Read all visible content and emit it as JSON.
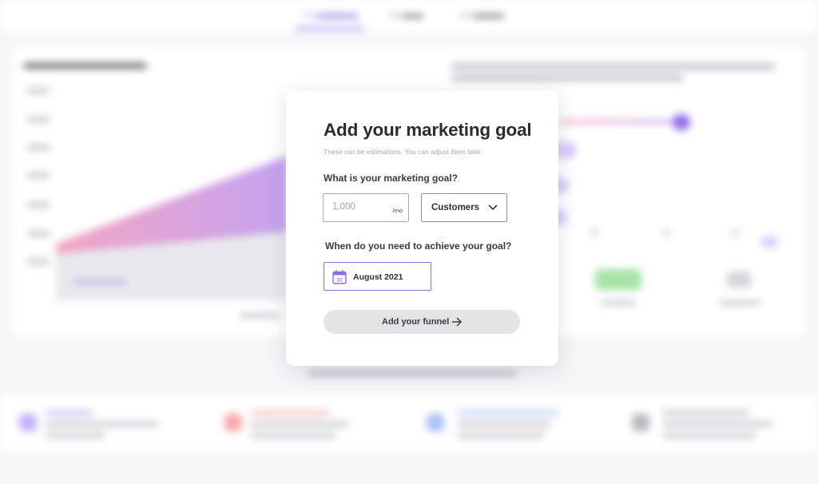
{
  "modal": {
    "title": "Add your marketing goal",
    "subtitle": "These can be estimations. You can adjust them later.",
    "goal_question": "What is your marketing goal?",
    "goal_amount": {
      "value": "",
      "placeholder": "1,000",
      "unit": "/mo"
    },
    "goal_type": {
      "selected": "Customers"
    },
    "deadline_question": "When do you need to achieve your goal?",
    "deadline": {
      "value": "August 2021",
      "calendar_day": "31"
    },
    "submit_label": "Add your funnel",
    "icons": {
      "select": "chevron-down-icon",
      "date": "calendar-icon",
      "submit": "arrow-right-icon"
    }
  },
  "colors": {
    "accent": "#8a6fe4",
    "button_bg": "#e4e4e6",
    "title": "#2b2b33"
  }
}
